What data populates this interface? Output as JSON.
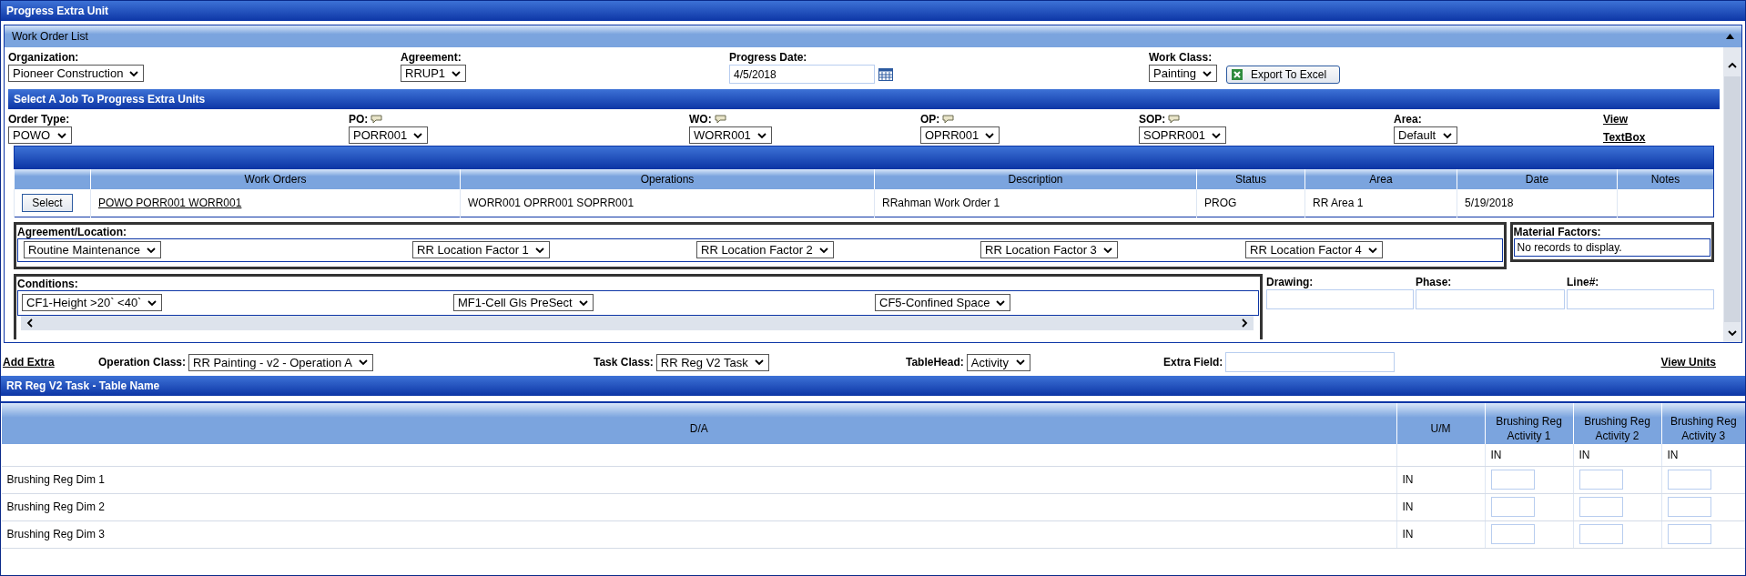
{
  "window": {
    "title": "Progress Extra Unit"
  },
  "work_order_list": {
    "title": "Work Order List",
    "filters": [
      {
        "label": "Organization:",
        "value": "Pioneer Construction",
        "kind": "select"
      },
      {
        "label": "Agreement:",
        "value": "RRUP1",
        "kind": "select"
      },
      {
        "label": "Progress Date:",
        "value": "4/5/2018",
        "kind": "date"
      },
      {
        "label": "Work Class:",
        "value": "Painting",
        "kind": "select"
      }
    ],
    "export_button": "Export To Excel",
    "job_section": {
      "title": "Select A Job To Progress Extra Units",
      "filters": [
        {
          "label": "Order Type:",
          "value": "POWO",
          "has_note": false
        },
        {
          "label": "PO:",
          "value": "PORR001",
          "has_note": true
        },
        {
          "label": "WO:",
          "value": "WORR001",
          "has_note": true
        },
        {
          "label": "OP:",
          "value": "OPRR001",
          "has_note": true
        },
        {
          "label": "SOP:",
          "value": "SOPRR001",
          "has_note": true
        },
        {
          "label": "Area:",
          "value": "Default",
          "has_note": false
        }
      ],
      "links": [
        "View",
        "TextBox"
      ]
    },
    "grid": {
      "columns": [
        "Work Orders",
        "Operations",
        "Description",
        "Status",
        "Area",
        "Date",
        "Notes"
      ],
      "rows": [
        {
          "button": "Select",
          "work_orders": "POWO PORR001 WORR001",
          "operations": "WORR001 OPRR001 SOPRR001",
          "description": "RRahman Work Order 1",
          "status": "PROG",
          "area": "RR Area 1",
          "date": "5/19/2018"
        }
      ]
    },
    "agreement_location": {
      "label": "Agreement/Location:",
      "selects": [
        "Routine Maintenance",
        "RR Location Factor 1",
        "RR Location Factor 2",
        "RR Location Factor 3",
        "RR Location Factor 4"
      ]
    },
    "material_factors": {
      "label": "Material Factors:",
      "message": "No records to display."
    },
    "conditions": {
      "label": "Conditions:",
      "selects": [
        "CF1-Height >20` <40`",
        "MF1-Cell Gls PreSect",
        "CF5-Confined Space"
      ]
    },
    "text_fields": [
      {
        "label": "Drawing:"
      },
      {
        "label": "Phase:"
      },
      {
        "label": "Line#:"
      }
    ]
  },
  "toolbar": {
    "add_extra": "Add Extra",
    "fields": [
      {
        "label": "Operation Class:",
        "value": "RR Painting - v2 - Operation A",
        "kind": "select"
      },
      {
        "label": "Task Class:",
        "value": "RR Reg V2 Task",
        "kind": "select"
      },
      {
        "label": "TableHead:",
        "value": "Activity",
        "kind": "select"
      },
      {
        "label": "Extra Field:",
        "kind": "input"
      }
    ],
    "view_units": "View Units"
  },
  "task_table": {
    "title": "RR Reg V2 Task - Table Name",
    "columns": [
      "D/A",
      "U/M",
      "Brushing Reg Activity 1",
      "Brushing Reg Activity 2",
      "Brushing Reg Activity 3"
    ],
    "unit_row": [
      "IN",
      "IN",
      "IN"
    ],
    "rows": [
      {
        "name": "Brushing Reg Dim 1",
        "unit": "IN"
      },
      {
        "name": "Brushing Reg Dim 2",
        "unit": "IN"
      },
      {
        "name": "Brushing Reg Dim 3",
        "unit": "IN"
      }
    ]
  }
}
